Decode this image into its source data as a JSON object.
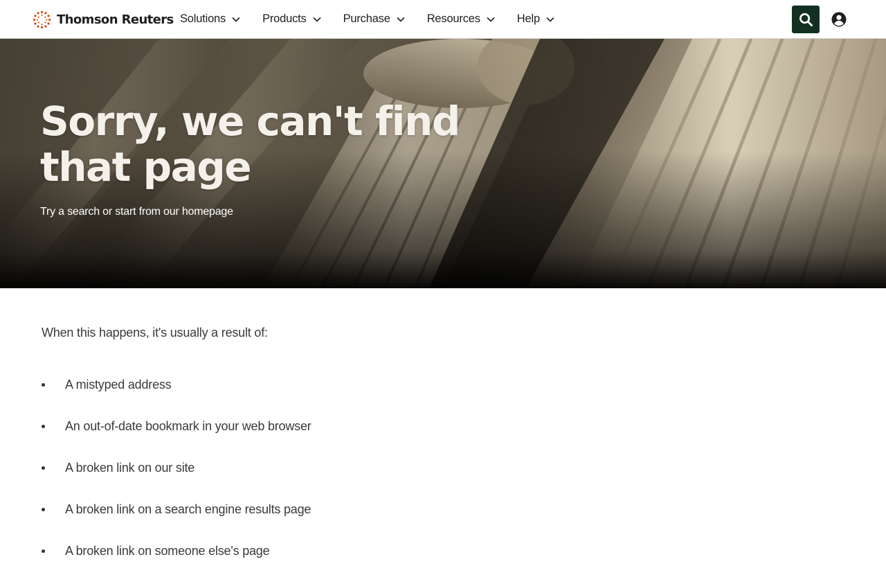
{
  "header": {
    "logo_text": "Thomson Reuters",
    "nav": [
      {
        "label": "Solutions"
      },
      {
        "label": "Products"
      },
      {
        "label": "Purchase"
      },
      {
        "label": "Resources"
      },
      {
        "label": "Help"
      }
    ],
    "search_icon": "search-icon",
    "account_icon": "user-circle-icon"
  },
  "hero": {
    "title": "Sorry, we can't find that page",
    "subtitle": "Try a search or start from our homepage"
  },
  "content": {
    "intro": "When this happens, it's usually a result of:",
    "causes": [
      "A mistyped address",
      "An out-of-date bookmark in your web browser",
      "A broken link on our site",
      "A broken link on a search engine results page",
      "A broken link on someone else's page"
    ]
  },
  "colors": {
    "logo_orange": "#d64000",
    "search_button_bg": "#123021",
    "text": "#333333"
  }
}
